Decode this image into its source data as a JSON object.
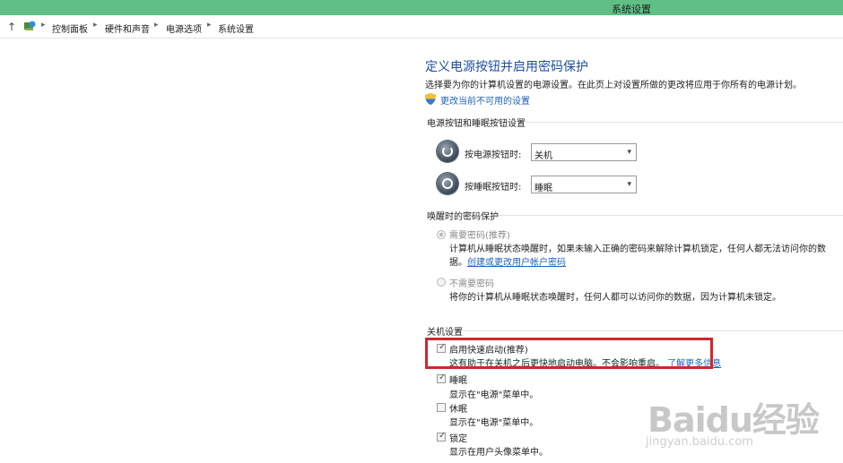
{
  "window": {
    "title": "系统设置"
  },
  "breadcrumb": [
    "控制面板",
    "硬件和声音",
    "电源选项",
    "系统设置"
  ],
  "main": {
    "heading": "定义电源按钮并启用密码保护",
    "description": "选择要为你的计算机设置的电源设置。在此页上对设置所做的更改将应用于你所有的电源计划。",
    "change_link": "更改当前不可用的设置"
  },
  "power_section": {
    "title": "电源按钮和睡眠按钮设置",
    "power_button_label": "按电源按钮时:",
    "power_button_value": "关机",
    "sleep_button_label": "按睡眠按钮时:",
    "sleep_button_value": "睡眠"
  },
  "wake_section": {
    "title": "唤醒时的密码保护",
    "require_title": "需要密码(推荐)",
    "require_desc_1": "计算机从睡眠状态唤醒时，如果未输入正确的密码来解除计算机锁定，任何人都无法访问你的数",
    "require_desc_2": "据。",
    "require_link": "创建或更改用户帐户密码",
    "norequire_title": "不需要密码",
    "norequire_desc": "将你的计算机从睡眠状态唤醒时，任何人都可以访问你的数据，因为计算机未锁定。"
  },
  "shutdown_section": {
    "title": "关机设置",
    "items": [
      {
        "label": "启用快速启动(推荐)",
        "desc": "这有助于在关机之后更快地启动电脑。不会影响重启。",
        "link": "了解更多信息",
        "checked": true
      },
      {
        "label": "睡眠",
        "desc": "显示在\"电源\"菜单中。",
        "checked": true
      },
      {
        "label": "休眠",
        "desc": "显示在\"电源\"菜单中。",
        "checked": false
      },
      {
        "label": "锁定",
        "desc": "显示在用户头像菜单中。",
        "checked": true
      }
    ]
  },
  "watermark": {
    "brand": "Baidu经验",
    "url": "jingyan.baidu.com"
  },
  "colors": {
    "titlebar": "#5fbf84",
    "heading": "#1e4e9e",
    "link": "#1f62b8",
    "highlight": "#d0272c"
  }
}
